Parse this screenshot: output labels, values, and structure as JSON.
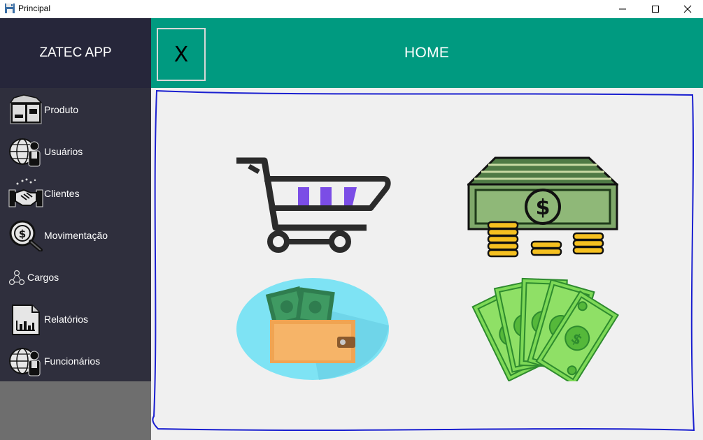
{
  "window": {
    "title": "Principal",
    "icons": {
      "app": "floppy-icon",
      "minimize": "minimize-icon",
      "maximize": "maximize-icon",
      "close": "close-icon"
    }
  },
  "sidebar": {
    "brand": "ZATEC APP",
    "items": [
      {
        "label": "Produto",
        "icon": "product-box-icon"
      },
      {
        "label": "Usuários",
        "icon": "globe-user-icon"
      },
      {
        "label": "Clientes",
        "icon": "handshake-icon"
      },
      {
        "label": "Movimentação",
        "icon": "money-search-icon"
      },
      {
        "label": "Cargos",
        "icon": "hierarchy-icon"
      },
      {
        "label": "Relatórios",
        "icon": "report-chart-icon"
      },
      {
        "label": "Funcionários",
        "icon": "globe-user-icon"
      }
    ]
  },
  "header": {
    "close_label": "X",
    "title": "HOME"
  },
  "tiles": [
    {
      "icon": "shopping-cart-icon"
    },
    {
      "icon": "money-stack-icon"
    },
    {
      "icon": "wallet-icon"
    },
    {
      "icon": "banknotes-fan-icon"
    }
  ],
  "colors": {
    "sidebar": "#2f2f3d",
    "brand_bg": "#26263a",
    "header": "#009a80",
    "frame_stroke": "#1a1fd0",
    "content_bg": "#f0f0f0"
  }
}
